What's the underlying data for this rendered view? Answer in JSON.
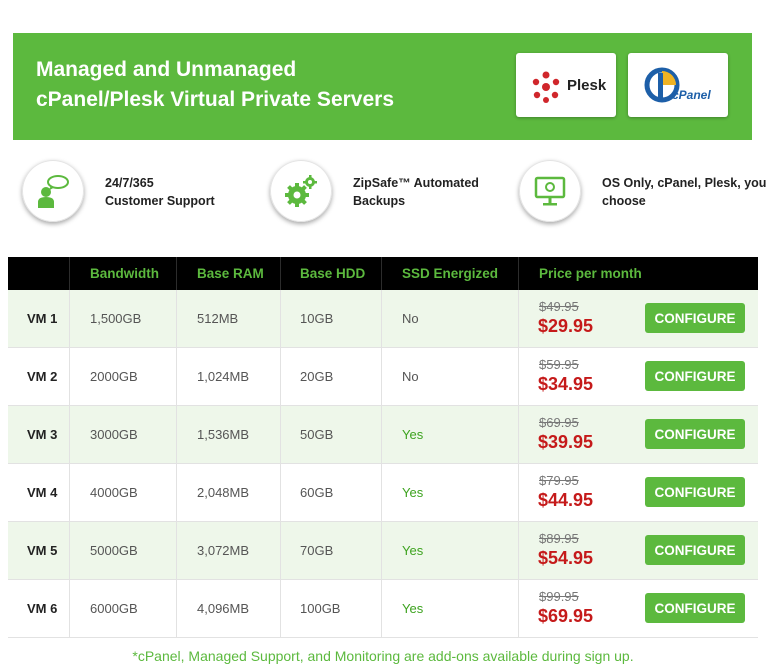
{
  "banner": {
    "title_line1": "Managed and Unmanaged",
    "title_line2": "cPanel/Plesk Virtual Private Servers",
    "plesk_label": "Plesk",
    "cpanel_label": "cPanel"
  },
  "features": [
    {
      "icon": "support-agent-icon",
      "line1": "24/7/365",
      "line2": "Customer Support"
    },
    {
      "icon": "gears-icon",
      "line1": "ZipSafe™ Automated",
      "line2": "Backups"
    },
    {
      "icon": "monitor-icon",
      "line1": "OS Only, cPanel, Plesk, you",
      "line2": "choose"
    }
  ],
  "table": {
    "headers": [
      "",
      "Bandwidth",
      "Base RAM",
      "Base HDD",
      "SSD Energized",
      "Price per month"
    ],
    "configure_label": "CONFIGURE",
    "rows": [
      {
        "name": "VM 1",
        "bandwidth": "1,500GB",
        "ram": "512MB",
        "hdd": "10GB",
        "ssd": "No",
        "old_price": "$49.95",
        "price": "$29.95"
      },
      {
        "name": "VM 2",
        "bandwidth": "2000GB",
        "ram": "1,024MB",
        "hdd": "20GB",
        "ssd": "No",
        "old_price": "$59.95",
        "price": "$34.95"
      },
      {
        "name": "VM 3",
        "bandwidth": "3000GB",
        "ram": "1,536MB",
        "hdd": "50GB",
        "ssd": "Yes",
        "old_price": "$69.95",
        "price": "$39.95"
      },
      {
        "name": "VM 4",
        "bandwidth": "4000GB",
        "ram": "2,048MB",
        "hdd": "60GB",
        "ssd": "Yes",
        "old_price": "$79.95",
        "price": "$44.95"
      },
      {
        "name": "VM 5",
        "bandwidth": "5000GB",
        "ram": "3,072MB",
        "hdd": "70GB",
        "ssd": "Yes",
        "old_price": "$89.95",
        "price": "$54.95"
      },
      {
        "name": "VM 6",
        "bandwidth": "6000GB",
        "ram": "4,096MB",
        "hdd": "100GB",
        "ssd": "Yes",
        "old_price": "$99.95",
        "price": "$69.95"
      }
    ]
  },
  "footnote": "*cPanel, Managed Support, and Monitoring are add-ons available during sign up.",
  "colors": {
    "brand_green": "#5cb93e",
    "price_red": "#c51a1a",
    "header_black": "#000000"
  }
}
